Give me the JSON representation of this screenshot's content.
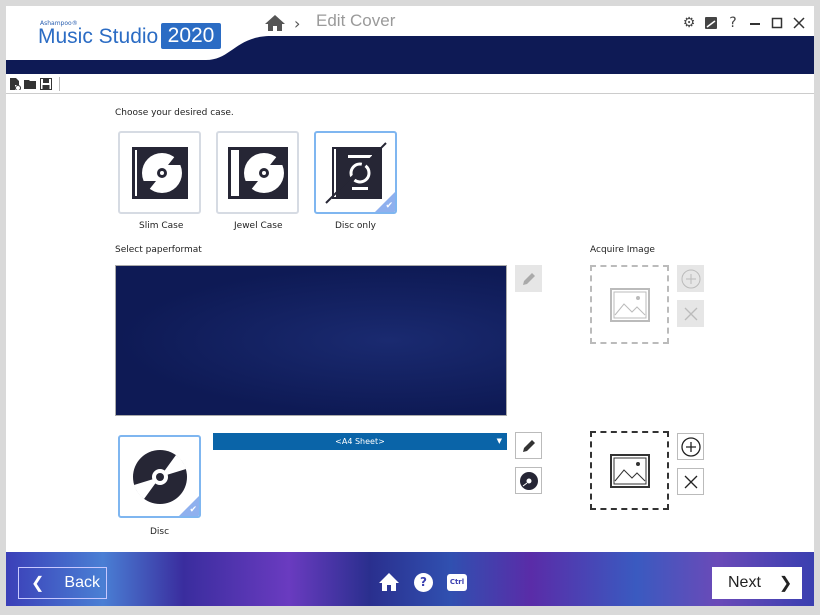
{
  "header": {
    "brand_small": "Ashampoo®",
    "brand": "Music Studio",
    "year": "2020",
    "breadcrumb_sep": "›",
    "title": "Edit Cover"
  },
  "window_controls": {
    "help": "?"
  },
  "main": {
    "case_prompt": "Choose your desired case.",
    "cases": [
      {
        "label": "Slim Case",
        "selected": false
      },
      {
        "label": "Jewel Case",
        "selected": false
      },
      {
        "label": "Disc only",
        "selected": true
      }
    ],
    "paper_label": "Select paperformat",
    "acquire_label": "Acquire Image",
    "paper_select": {
      "value": "<A4 Sheet>"
    },
    "disc": {
      "label": "Disc",
      "selected": true
    }
  },
  "footer": {
    "back": "Back",
    "next": "Next",
    "ctrl": "Ctrl",
    "help": "?"
  },
  "colors": {
    "accent": "#2b6cc4",
    "select": "#0a64a8",
    "navy": "#0e1a55"
  }
}
